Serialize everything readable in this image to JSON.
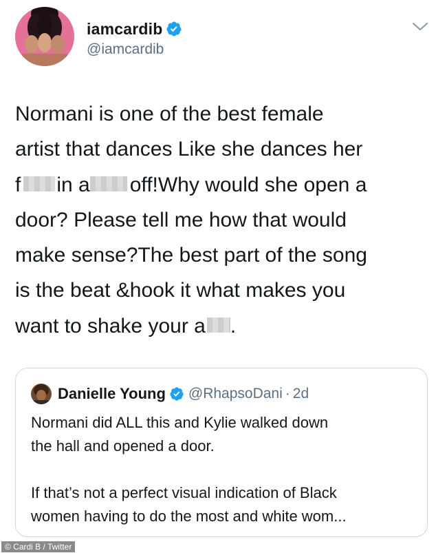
{
  "tweet": {
    "display_name": "iamcardib",
    "handle": "@iamcardib",
    "text": {
      "line1": "Normani is one of the best female",
      "line2": "artist that dances Like she dances her",
      "line3_a": "f",
      "line3_b": "in a",
      "line3_c": "off!Why would she open a",
      "line4": "door? Please tell me how that would",
      "line5": "make sense?The best part of the song",
      "line6": "is the beat &hook  it what makes you",
      "line7_a": "want to shake your a",
      "line7_b": "."
    }
  },
  "quoted_tweet": {
    "display_name": "Danielle Young",
    "handle": "@RhapsoDani",
    "separator": "·",
    "time": "2d",
    "text": {
      "line1": "Normani did ALL this and Kylie walked down",
      "line2": "the hall and opened a door.",
      "line3": "If that’s not a perfect visual indication of Black",
      "line4": "women having to do the most and white wom..."
    }
  },
  "photo_credit": "© Cardi B / Twitter",
  "colors": {
    "verified": "#1da1f2",
    "secondary_text": "#5b7083",
    "border": "#cfd9de",
    "avatar_background": "#e5709a"
  },
  "icons": {
    "verified": "verified-badge-icon",
    "more": "chevron-down-icon"
  }
}
